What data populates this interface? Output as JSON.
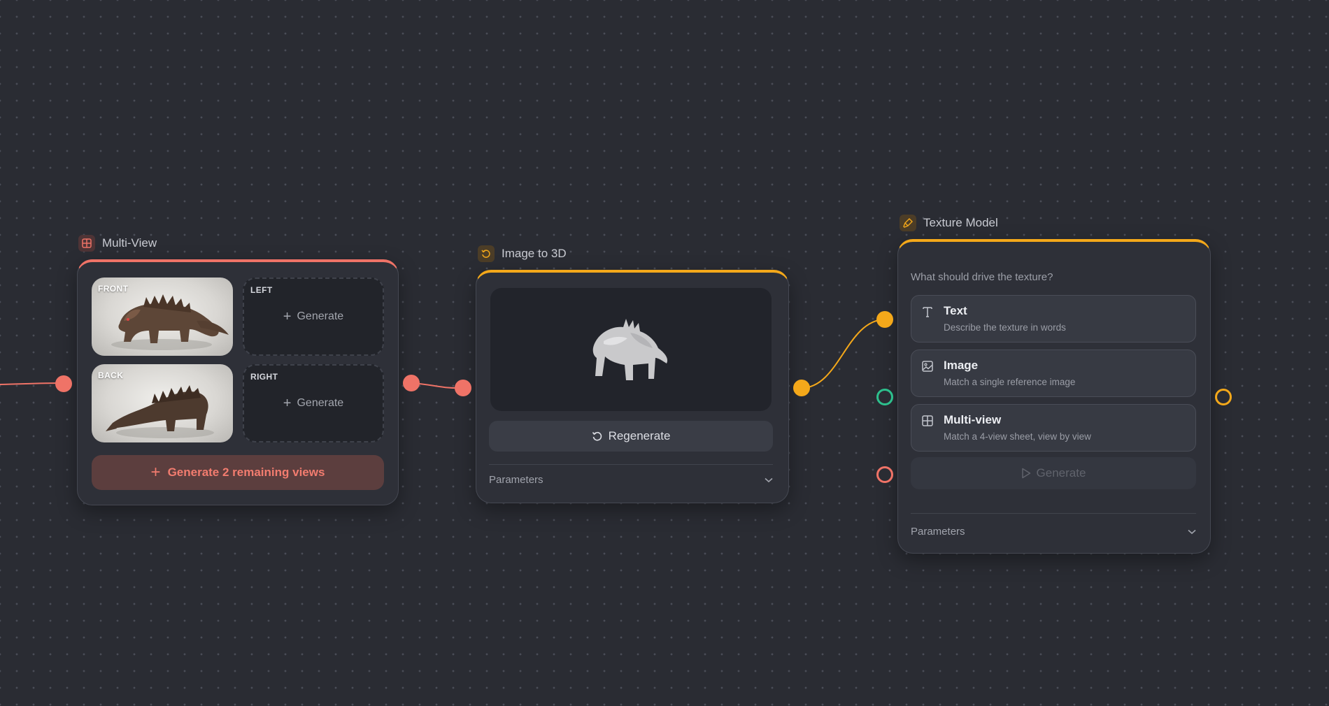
{
  "canvas": {
    "nodes": {
      "multi_view": {
        "title": "Multi-View",
        "views": [
          {
            "label": "FRONT",
            "state": "filled"
          },
          {
            "label": "LEFT",
            "state": "empty",
            "action": "Generate"
          },
          {
            "label": "BACK",
            "state": "filled"
          },
          {
            "label": "RIGHT",
            "state": "empty",
            "action": "Generate"
          }
        ],
        "generate_remaining_label": "Generate 2 remaining views"
      },
      "image_to_3d": {
        "title": "Image to 3D",
        "regenerate_label": "Regenerate",
        "parameters_label": "Parameters"
      },
      "texture_model": {
        "title": "Texture Model",
        "question": "What should drive the texture?",
        "options": [
          {
            "title": "Text",
            "description": "Describe the texture in words",
            "icon": "text-icon"
          },
          {
            "title": "Image",
            "description": "Match a single reference image",
            "icon": "image-icon"
          },
          {
            "title": "Multi-view",
            "description": "Match a 4-view sheet, view by view",
            "icon": "grid-icon"
          }
        ],
        "generate_label": "Generate",
        "parameters_label": "Parameters"
      }
    },
    "colors": {
      "background": "#2a2c33",
      "coral_accent": "#ef7367",
      "amber_accent": "#f4a81a",
      "green_port": "#2dc08d"
    }
  }
}
